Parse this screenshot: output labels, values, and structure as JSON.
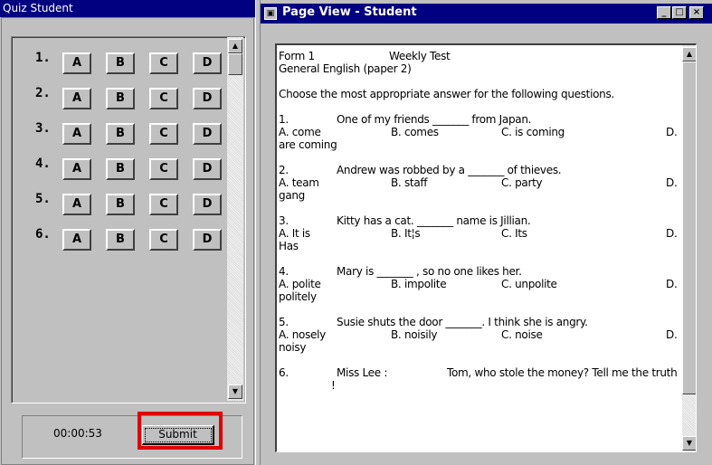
{
  "left_window": {
    "title": "Quiz Student",
    "questions": [
      {
        "num": "1.",
        "options": [
          "A",
          "B",
          "C",
          "D"
        ]
      },
      {
        "num": "2.",
        "options": [
          "A",
          "B",
          "C",
          "D"
        ]
      },
      {
        "num": "3.",
        "options": [
          "A",
          "B",
          "C",
          "D"
        ]
      },
      {
        "num": "4.",
        "options": [
          "A",
          "B",
          "C",
          "D"
        ]
      },
      {
        "num": "5.",
        "options": [
          "A",
          "B",
          "C",
          "D"
        ]
      },
      {
        "num": "6.",
        "options": [
          "A",
          "B",
          "C",
          "D"
        ]
      }
    ],
    "timer": "00:00:53",
    "submit_label": "Submit",
    "highlight_color": "#e00000"
  },
  "right_window": {
    "title": "Page View - Student",
    "controls": {
      "minimize": "_",
      "maximize": "□",
      "close": "×"
    },
    "document": {
      "form": "Form 1",
      "test": "Weekly Test",
      "subject": "General English (paper 2)",
      "instruction": "Choose the most appropriate answer for the following questions.",
      "questions": [
        {
          "num": "1.",
          "stem": "One of my friends _______ from Japan.",
          "a": "A. come",
          "b": "B. comes",
          "c": "C. is coming",
          "d": "D.",
          "d_cont": "are coming"
        },
        {
          "num": "2.",
          "stem": "Andrew was robbed by a _______ of thieves.",
          "a": "A. team",
          "b": "B. staff",
          "c": "C. party",
          "d": "D.",
          "d_cont": "gang"
        },
        {
          "num": "3.",
          "stem": "Kitty has a cat. _______ name is Jillian.",
          "a": "A. It is",
          "b": "B. It¦s",
          "c": "C. Its",
          "d": "D.",
          "d_cont": "Has"
        },
        {
          "num": "4.",
          "stem": "Mary is _______ , so no one likes her.",
          "a": "A. polite",
          "b": "B. impolite",
          "c": "C. unpolite",
          "d": "D.",
          "d_cont": "politely"
        },
        {
          "num": "5.",
          "stem": "Susie shuts the door _______. I think she is angry.",
          "a": "A. nosely",
          "b": "B. noisily",
          "c": "C. noise",
          "d": "D.",
          "d_cont": "noisy"
        }
      ],
      "q6": {
        "num": "6.",
        "speaker": "Miss Lee :",
        "line": "Tom, who stole the money? Tell me the truth",
        "cont": "!"
      }
    }
  }
}
